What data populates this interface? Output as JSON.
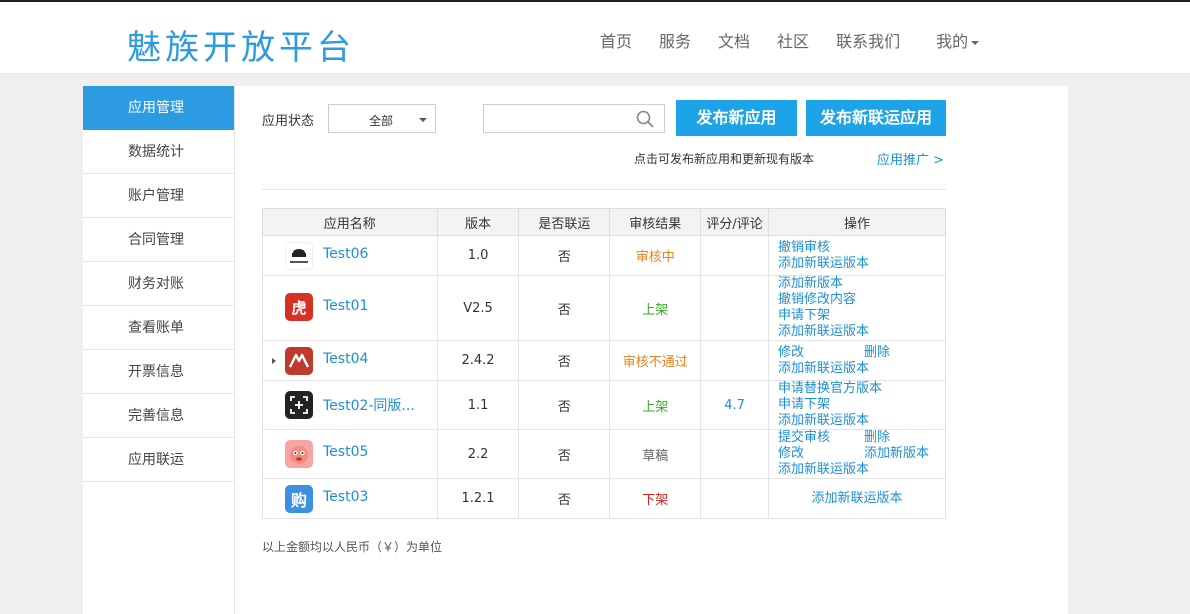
{
  "header": {
    "logo": "魅族开放平台",
    "nav": [
      "首页",
      "服务",
      "文档",
      "社区",
      "联系我们"
    ],
    "mine": "我的"
  },
  "sidebar": {
    "items": [
      {
        "label": "应用管理"
      },
      {
        "label": "数据统计"
      },
      {
        "label": "账户管理"
      },
      {
        "label": "合同管理"
      },
      {
        "label": "财务对账"
      },
      {
        "label": "查看账单"
      },
      {
        "label": "开票信息"
      },
      {
        "label": "完善信息"
      },
      {
        "label": "应用联运"
      }
    ]
  },
  "filter": {
    "status_label": "应用状态",
    "status_value": "全部",
    "search_value": "",
    "search_placeholder": ""
  },
  "buttons": {
    "publish_new": "发布新应用",
    "publish_joint": "发布新联运应用"
  },
  "hint": "点击可发布新应用和更新现有版本",
  "promo": "应用推广 >",
  "table": {
    "headers": [
      "应用名称",
      "版本",
      "是否联运",
      "审核结果",
      "评分/评论",
      "操作"
    ],
    "rows": [
      {
        "name": "Test06",
        "version": "1.0",
        "joint": "否",
        "status": "审核中",
        "rating": "",
        "ops": [
          [
            "撤销审核"
          ],
          [
            "添加新联运版本"
          ]
        ]
      },
      {
        "name": "Test01",
        "version": "V2.5",
        "joint": "否",
        "status": "上架",
        "rating": "",
        "ops": [
          [
            "添加新版本"
          ],
          [
            "撤销修改内容"
          ],
          [
            "申请下架"
          ],
          [
            "添加新联运版本"
          ]
        ]
      },
      {
        "name": "Test04",
        "version": "2.4.2",
        "joint": "否",
        "status": "审核不通过",
        "rating": "",
        "ops": [
          [
            "修改",
            "删除"
          ],
          [
            "添加新联运版本"
          ]
        ]
      },
      {
        "name": "Test02-同版...",
        "version": "1.1",
        "joint": "否",
        "status": "上架",
        "rating": "4.7",
        "ops": [
          [
            "申请替换官方版本"
          ],
          [
            "申请下架"
          ],
          [
            "添加新联运版本"
          ]
        ]
      },
      {
        "name": "Test05",
        "version": "2.2",
        "joint": "否",
        "status": "草稿",
        "rating": "",
        "ops": [
          [
            "提交审核",
            "删除"
          ],
          [
            "修改",
            "添加新版本"
          ],
          [
            "添加新联运版本"
          ]
        ]
      },
      {
        "name": "Test03",
        "version": "1.2.1",
        "joint": "否",
        "status": "下架",
        "rating": "",
        "ops": [
          [
            "添加新联运版本"
          ]
        ]
      }
    ]
  },
  "footnote": "以上金额均以人民币（￥）为单位",
  "colors": {
    "accent": "#2d9be2",
    "button": "#1da3e8",
    "link": "#1d8fd6",
    "status_reviewing": "#e8821e",
    "status_online": "#3aa829",
    "status_draft": "#666666",
    "status_offline": "#d42020"
  }
}
